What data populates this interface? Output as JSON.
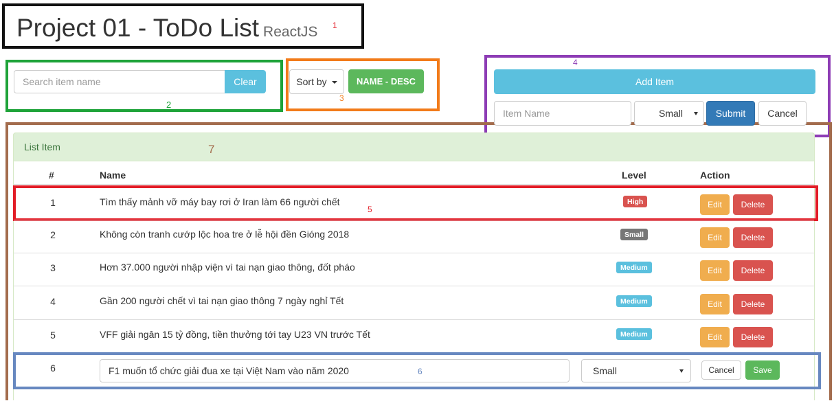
{
  "header": {
    "title": "Project 01 - ToDo List",
    "subtitle": "ReactJS"
  },
  "annotations": {
    "a1": "1",
    "a2": "2",
    "a3": "3",
    "a4": "4",
    "a5": "5",
    "a6": "6",
    "a7": "7"
  },
  "search": {
    "placeholder": "Search item name",
    "clear_label": "Clear"
  },
  "sort": {
    "button_label": "Sort by",
    "current": "NAME - DESC"
  },
  "add_form": {
    "add_button_label": "Add Item",
    "name_placeholder": "Item Name",
    "level_selected": "Small",
    "submit_label": "Submit",
    "cancel_label": "Cancel"
  },
  "list": {
    "heading": "List Item",
    "columns": {
      "num": "#",
      "name": "Name",
      "level": "Level",
      "action": "Action"
    },
    "rows": [
      {
        "num": "1",
        "name": "Tìm thấy mảnh vỡ máy bay rơi ở Iran làm 66 người chết",
        "level": "High",
        "level_color": "#d9534f",
        "edit_label": "Edit",
        "delete_label": "Delete"
      },
      {
        "num": "2",
        "name": "Không còn tranh cướp lộc hoa tre ở lễ hội đền Gióng 2018",
        "level": "Small",
        "level_color": "#777777",
        "edit_label": "Edit",
        "delete_label": "Delete"
      },
      {
        "num": "3",
        "name": "Hơn 37.000 người nhập viện vì tai nạn giao thông, đốt pháo",
        "level": "Medium",
        "level_color": "#5bc0de",
        "edit_label": "Edit",
        "delete_label": "Delete"
      },
      {
        "num": "4",
        "name": "Gần 200 người chết vì tai nạn giao thông 7 ngày nghỉ Tết",
        "level": "Medium",
        "level_color": "#5bc0de",
        "edit_label": "Edit",
        "delete_label": "Delete"
      },
      {
        "num": "5",
        "name": "VFF giải ngân 15 tỷ đồng, tiền thưởng tới tay U23 VN trước Tết",
        "level": "Medium",
        "level_color": "#5bc0de",
        "edit_label": "Edit",
        "delete_label": "Delete"
      }
    ],
    "edit_row": {
      "num": "6",
      "name_value": "F1 muốn tổ chức giải đua xe tại Việt Nam vào năm 2020",
      "level_selected": "Small",
      "cancel_label": "Cancel",
      "save_label": "Save"
    }
  },
  "colors": {
    "annotation_title_box": "#111111",
    "annotation_search_box": "#1ea339",
    "annotation_sort_box": "#f27b1a",
    "annotation_add_box": "#8d3cb5",
    "annotation_list_box": "#a36c4d",
    "annotation_row_box": "#e21c26",
    "annotation_edit_box": "#6788c0"
  }
}
